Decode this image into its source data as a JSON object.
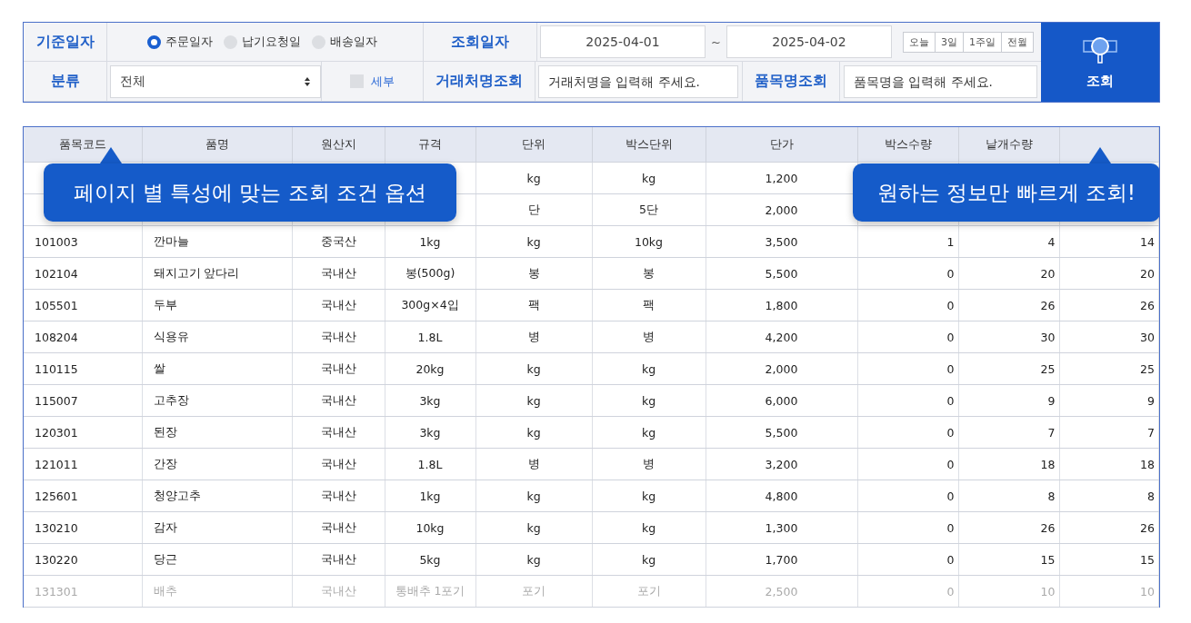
{
  "filter": {
    "date_basis": {
      "label": "기준일자",
      "options": [
        {
          "label": "주문일자",
          "selected": true
        },
        {
          "label": "납기요청일",
          "selected": false
        },
        {
          "label": "배송일자",
          "selected": false
        }
      ]
    },
    "date_range": {
      "label": "조회일자",
      "from": "2025-04-01",
      "separator": "~",
      "to": "2025-04-02",
      "quick": [
        "오늘",
        "3일",
        "1주일",
        "전월"
      ]
    },
    "category": {
      "label": "분류",
      "value": "전체"
    },
    "detail": {
      "label": "세부",
      "checked": false
    },
    "client": {
      "label": "거래처명조회",
      "placeholder": "거래처명을 입력해 주세요."
    },
    "item": {
      "label": "품목명조회",
      "placeholder": "품목명을 입력해 주세요."
    },
    "search_button": "조회"
  },
  "table": {
    "columns": [
      "품목코드",
      "품명",
      "원산지",
      "규격",
      "단위",
      "박스단위",
      "단가",
      "박스수량",
      "낱개수량",
      ""
    ],
    "rows": [
      {
        "faded": false,
        "cells": [
          "",
          "",
          "",
          "",
          "kg",
          "kg",
          "1,200",
          "",
          "",
          ""
        ]
      },
      {
        "faded": false,
        "cells": [
          "",
          "",
          "",
          "",
          "단",
          "5단",
          "2,000",
          "",
          "",
          ""
        ]
      },
      {
        "faded": false,
        "cells": [
          "101003",
          "깐마늘",
          "중국산",
          "1kg",
          "kg",
          "10kg",
          "3,500",
          "1",
          "4",
          "14"
        ]
      },
      {
        "faded": false,
        "cells": [
          "102104",
          "돼지고기 앞다리",
          "국내산",
          "봉(500g)",
          "봉",
          "봉",
          "5,500",
          "0",
          "20",
          "20"
        ]
      },
      {
        "faded": false,
        "cells": [
          "105501",
          "두부",
          "국내산",
          "300g×4입",
          "팩",
          "팩",
          "1,800",
          "0",
          "26",
          "26"
        ]
      },
      {
        "faded": false,
        "cells": [
          "108204",
          "식용유",
          "국내산",
          "1.8L",
          "병",
          "병",
          "4,200",
          "0",
          "30",
          "30"
        ]
      },
      {
        "faded": false,
        "cells": [
          "110115",
          "쌀",
          "국내산",
          "20kg",
          "kg",
          "kg",
          "2,000",
          "0",
          "25",
          "25"
        ]
      },
      {
        "faded": false,
        "cells": [
          "115007",
          "고추장",
          "국내산",
          "3kg",
          "kg",
          "kg",
          "6,000",
          "0",
          "9",
          "9"
        ]
      },
      {
        "faded": false,
        "cells": [
          "120301",
          "된장",
          "국내산",
          "3kg",
          "kg",
          "kg",
          "5,500",
          "0",
          "7",
          "7"
        ]
      },
      {
        "faded": false,
        "cells": [
          "121011",
          "간장",
          "국내산",
          "1.8L",
          "병",
          "병",
          "3,200",
          "0",
          "18",
          "18"
        ]
      },
      {
        "faded": false,
        "cells": [
          "125601",
          "청양고추",
          "국내산",
          "1kg",
          "kg",
          "kg",
          "4,800",
          "0",
          "8",
          "8"
        ]
      },
      {
        "faded": false,
        "cells": [
          "130210",
          "감자",
          "국내산",
          "10kg",
          "kg",
          "kg",
          "1,300",
          "0",
          "26",
          "26"
        ]
      },
      {
        "faded": false,
        "cells": [
          "130220",
          "당근",
          "국내산",
          "5kg",
          "kg",
          "kg",
          "1,700",
          "0",
          "15",
          "15"
        ]
      },
      {
        "faded": true,
        "cells": [
          "131301",
          "배추",
          "국내산",
          "통배추 1포기",
          "포기",
          "포기",
          "2,500",
          "0",
          "10",
          "10"
        ]
      }
    ]
  },
  "callouts": [
    {
      "text": "페이지 별 특성에 맞는 조회 조건 옵션"
    },
    {
      "text": "원하는 정보만 빠르게 조회!"
    }
  ]
}
